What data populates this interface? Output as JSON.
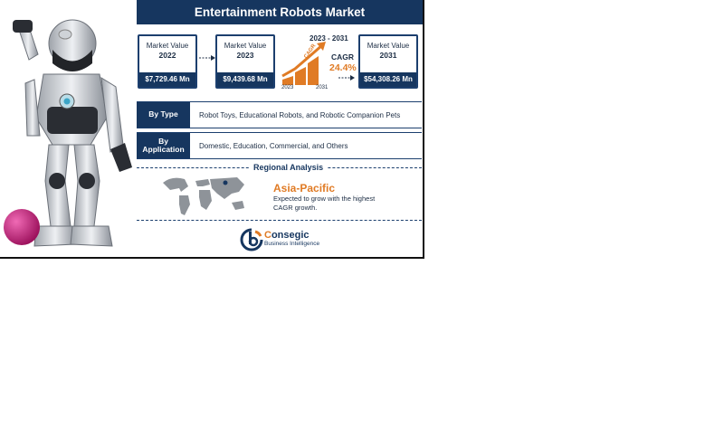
{
  "header": {
    "title": "Entertainment Robots Market"
  },
  "market_values": [
    {
      "label": "Market Value",
      "year": "2022",
      "value": "$7,729.46 Mn"
    },
    {
      "label": "Market Value",
      "year": "2023",
      "value": "$9,439.68 Mn"
    },
    {
      "label": "Market Value",
      "year": "2031",
      "value": "$54,308.26 Mn"
    }
  ],
  "cagr": {
    "period": "2023 - 2031",
    "label": "CAGR",
    "value": "24.4%",
    "start_year": "2023",
    "end_year": "2031",
    "tag": "CAGR"
  },
  "segments": [
    {
      "label": "By Type",
      "text": "Robot Toys, Educational Robots, and Robotic Companion Pets"
    },
    {
      "label": "By Application",
      "text": "Domestic, Education, Commercial, and Others"
    }
  ],
  "regional": {
    "title": "Regional Analysis",
    "region": "Asia-Pacific",
    "description": "Expected to grow with the highest CAGR growth."
  },
  "brand": {
    "initial": "C",
    "rest": "onsegic",
    "subtitle": "Business Intelligence"
  },
  "colors": {
    "navy": "#16365f",
    "orange": "#e07b25",
    "ball": "#c8177a"
  }
}
